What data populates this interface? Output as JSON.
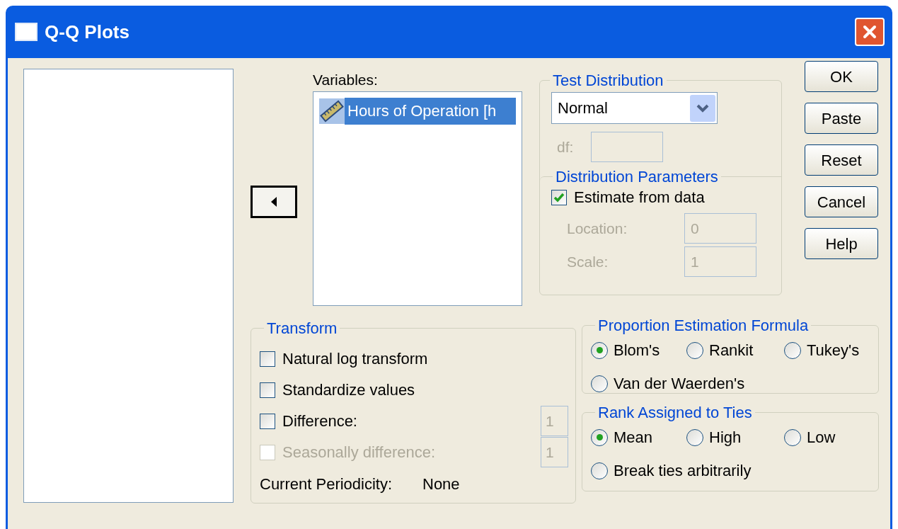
{
  "window": {
    "title": "Q-Q Plots"
  },
  "variables": {
    "label": "Variables:",
    "items": [
      {
        "text": "Hours of Operation [h",
        "selected": true
      }
    ]
  },
  "test_distribution": {
    "legend": "Test Distribution",
    "dropdown": "Normal",
    "df": {
      "label": "df:",
      "disabled": true
    }
  },
  "distribution_parameters": {
    "legend": "Distribution Parameters",
    "estimate": {
      "label": "Estimate from data",
      "checked": true
    },
    "fields": [
      {
        "label": "Location:",
        "value": "0",
        "disabled": true
      },
      {
        "label": "Scale:",
        "value": "1",
        "disabled": true
      }
    ]
  },
  "buttons": [
    "OK",
    "Paste",
    "Reset",
    "Cancel",
    "Help"
  ],
  "transform": {
    "legend": "Transform",
    "options": [
      {
        "label": "Natural log transform",
        "checked": false,
        "disabled": false
      },
      {
        "label": "Standardize values",
        "checked": false,
        "disabled": false
      },
      {
        "label": "Difference:",
        "checked": false,
        "disabled": false,
        "value": "1"
      },
      {
        "label": "Seasonally difference:",
        "checked": false,
        "disabled": true,
        "value": "1"
      }
    ],
    "periodicity": {
      "label": "Current Periodicity:",
      "value": "None"
    }
  },
  "proportion_formula": {
    "legend": "Proportion Estimation Formula",
    "options": [
      {
        "label": "Blom's",
        "selected": true
      },
      {
        "label": "Rankit",
        "selected": false
      },
      {
        "label": "Tukey's",
        "selected": false
      },
      {
        "label": "Van der Waerden's",
        "selected": false
      }
    ]
  },
  "rank_ties": {
    "legend": "Rank Assigned to Ties",
    "options": [
      {
        "label": "Mean",
        "selected": true
      },
      {
        "label": "High",
        "selected": false
      },
      {
        "label": "Low",
        "selected": false
      },
      {
        "label": "Break ties arbitrarily",
        "selected": false
      }
    ]
  }
}
